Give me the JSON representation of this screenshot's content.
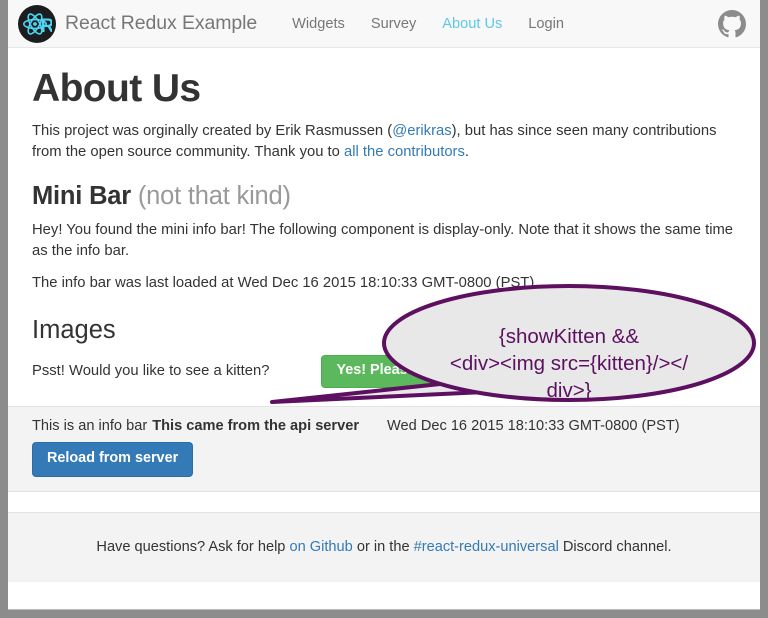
{
  "navbar": {
    "brand": "React Redux Example",
    "logo_icon": "react-logo-icon",
    "github_icon": "github-icon",
    "links": [
      {
        "label": "Widgets",
        "active": false
      },
      {
        "label": "Survey",
        "active": false
      },
      {
        "label": "About Us",
        "active": true
      },
      {
        "label": "Login",
        "active": false
      }
    ]
  },
  "main": {
    "title": "About Us",
    "intro": {
      "part1": "This project was orginally created by Erik Rasmussen (",
      "link1": "@erikras",
      "part2": "), but has since seen many contributions from the open source community. Thank you to ",
      "link2": "all the contributors",
      "part3": "."
    },
    "minibar": {
      "heading": "Mini Bar",
      "heading_small": "(not that kind)",
      "paragraph": "Hey! You found the mini info bar! The following component is display-only. Note that it shows the same time as the info bar.",
      "loaded_text": "The info bar was last loaded at Wed Dec 16 2015 18:10:33 GMT-0800 (PST)"
    },
    "images": {
      "heading": "Images",
      "question": "Psst! Would you like to see a kitten?",
      "button_label": "Yes! Please!"
    }
  },
  "callout": {
    "line1": "{showKitten &&",
    "line2": "<div><img src={kitten}/></",
    "line3": "div>}",
    "stroke_color": "#5d1060",
    "fill_color": "#e8e8e8"
  },
  "infobar": {
    "text": "This is an info bar",
    "strong_text": "This came from the api server",
    "timestamp": "Wed Dec 16 2015 18:10:33 GMT-0800 (PST)",
    "button_label": "Reload from server"
  },
  "footer": {
    "part1": "Have questions? Ask for help ",
    "link1": "on Github",
    "part2": " or in the ",
    "link2": "#react-redux-universal",
    "part3": " Discord channel."
  },
  "colors": {
    "brand_cyan": "#5bc8e8",
    "link_blue": "#337ab7",
    "success_green": "#5cb85c",
    "purple": "#5d1060"
  }
}
